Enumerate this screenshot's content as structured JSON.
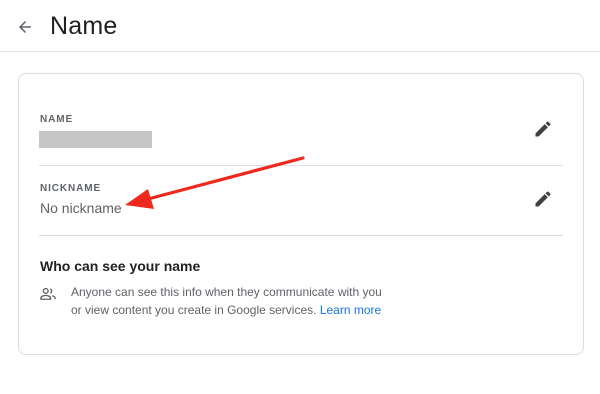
{
  "header": {
    "back_icon": "arrow-left-icon",
    "title": "Name"
  },
  "name_field": {
    "label": "NAME",
    "value_redacted": true,
    "edit_icon": "pencil-icon"
  },
  "nickname_field": {
    "label": "NICKNAME",
    "value": "No nickname",
    "edit_icon": "pencil-icon"
  },
  "visibility": {
    "heading": "Who can see your name",
    "icon": "people-icon",
    "description": "Anyone can see this info when they communicate with you or view content you create in Google services.",
    "link_text": "Learn more"
  },
  "annotation": {
    "arrow_color": "#f0281e"
  },
  "colors": {
    "text_primary": "#202124",
    "text_secondary": "#5f6368",
    "link": "#1a73e8",
    "border": "#dadce0"
  }
}
